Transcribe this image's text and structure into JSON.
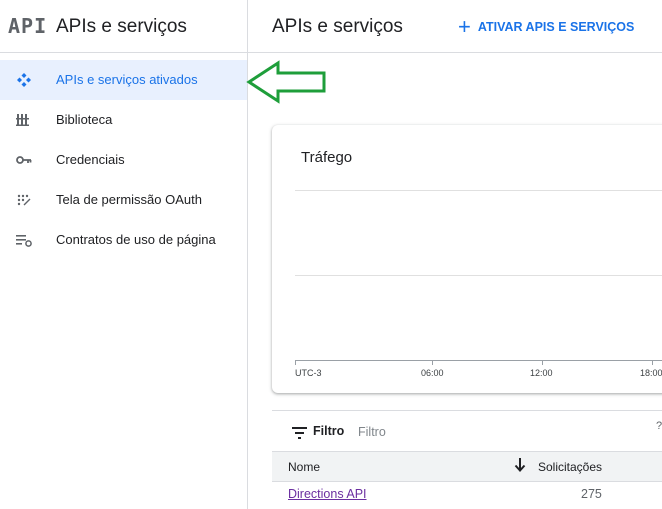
{
  "sidebar": {
    "logo": "API",
    "title": "APIs e serviços",
    "items": [
      {
        "label": "APIs e serviços ativados",
        "icon": "diamond-dots-icon",
        "active": true
      },
      {
        "label": "Biblioteca",
        "icon": "library-icon",
        "active": false
      },
      {
        "label": "Credenciais",
        "icon": "key-icon",
        "active": false
      },
      {
        "label": "Tela de permissão OAuth",
        "icon": "consent-icon",
        "active": false
      },
      {
        "label": "Contratos de uso de página",
        "icon": "page-settings-icon",
        "active": false
      }
    ]
  },
  "header": {
    "title": "APIs e serviços",
    "enable_button": "ATIVAR APIS E SERVIÇOS"
  },
  "traffic": {
    "title": "Tráfego",
    "x_labels": [
      "UTC-3",
      "06:00",
      "12:00",
      "18:00"
    ]
  },
  "filter": {
    "label": "Filtro",
    "placeholder": "Filtro",
    "edge": "?"
  },
  "table": {
    "columns": [
      "Nome",
      "Solicitações"
    ],
    "rows": [
      {
        "name": "Directions API",
        "requests": "275"
      }
    ]
  },
  "colors": {
    "accent": "#1a73e8",
    "active_bg": "#e8f0fe",
    "annotation_arrow": "#1e9e3a"
  }
}
